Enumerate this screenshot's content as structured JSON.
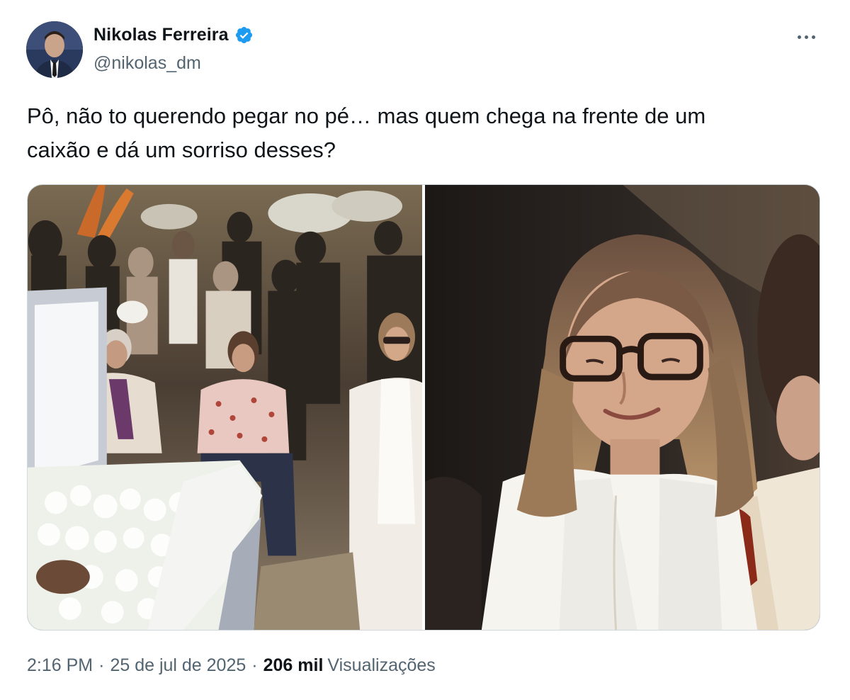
{
  "author": {
    "name": "Nikolas Ferreira",
    "handle": "@nikolas_dm",
    "verified": true,
    "verified_color": "#1d9bf0"
  },
  "tweet": {
    "text_line1": "Pô, não to querendo pegar no pé… mas quem chega na frente de um",
    "text_line2": "caixão e dá um sorriso desses?"
  },
  "media": {
    "photos": [
      {
        "name": "funeral-crowd-photo"
      },
      {
        "name": "woman-smiling-closeup-photo"
      }
    ]
  },
  "meta": {
    "time": "2:16 PM",
    "separator": "·",
    "date": "25 de jul de 2025",
    "views_count": "206 mil",
    "views_label": "Visualizações"
  },
  "icons": {
    "more": "more-options-icon",
    "verified": "verified-badge-icon"
  }
}
